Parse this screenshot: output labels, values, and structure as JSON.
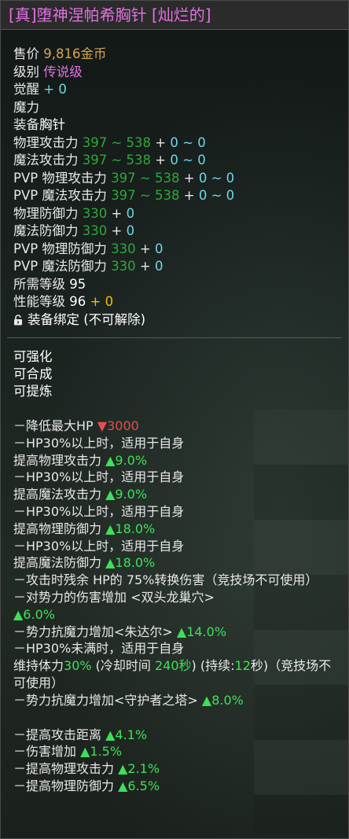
{
  "title": "[真]堕神涅帕希胸针 [灿烂的]",
  "basic": {
    "price_label": "售价",
    "price_value": "9,816金币",
    "grade_label": "级别",
    "grade_value": "传说级",
    "awaken_label": "觉醒",
    "awaken_value": "+ 0",
    "magic_label": "魔力",
    "equip_label": "装备",
    "equip_value": "胸针"
  },
  "stats": [
    {
      "label": "物理攻击力",
      "range": "397 ~ 538",
      "plus": " + ",
      "bonus": "0 ~ 0"
    },
    {
      "label": "魔法攻击力",
      "range": "397 ~ 538",
      "plus": " + ",
      "bonus": "0 ~ 0"
    },
    {
      "label": "PVP 物理攻击力",
      "range": "397 ~ 538",
      "plus": " + ",
      "bonus": "0 ~ 0"
    },
    {
      "label": "PVP 魔法攻击力",
      "range": "397 ~ 538",
      "plus": " + ",
      "bonus": "0 ~ 0"
    },
    {
      "label": "物理防御力",
      "range": "330",
      "plus": " + ",
      "bonus": "0"
    },
    {
      "label": "魔法防御力",
      "range": "330",
      "plus": " + ",
      "bonus": "0"
    },
    {
      "label": "PVP 物理防御力",
      "range": "330",
      "plus": " + ",
      "bonus": "0"
    },
    {
      "label": "PVP 魔法防御力",
      "range": "330",
      "plus": " + ",
      "bonus": "0"
    }
  ],
  "required_level_label": "所需等级",
  "required_level_value": "95",
  "perf_level_label": "性能等级",
  "perf_level_value": "96",
  "perf_level_bonus": "+ 0",
  "bind_text": "装备绑定 (不可解除)",
  "properties": [
    "可强化",
    "可合成",
    "可提炼"
  ],
  "effects": {
    "e1_text": "－降低最大HP ",
    "e1_value": "▼3000",
    "e2": "－HP30%以上时，适用于自身",
    "e3_text": " 提高物理攻击力 ",
    "e3_value": "▲9.0%",
    "e4": "－HP30%以上时，适用于自身",
    "e5_text": " 提高魔法攻击力 ",
    "e5_value": "▲9.0%",
    "e6": "－HP30%以上时，适用于自身",
    "e7_text": " 提高物理防御力 ",
    "e7_value": "▲18.0%",
    "e8": "－HP30%以上时，适用于自身",
    "e9_text": " 提高魔法防御力 ",
    "e9_value": "▲18.0%",
    "e10": "－攻击时残余 HP的 75%转换伤害（竞技场不可使用）",
    "e11": "－对势力的伤害增加 <双头龙巢穴>",
    "e11_value": "▲6.0%",
    "e12_text": "－势力抗魔力增加<朱达尔> ",
    "e12_value": "▲14.0%",
    "e13": "－HP30%未满时，适用于自身",
    "e14_a": " 维持体力",
    "e14_pct": "30%",
    "e14_b": " (冷却时间 ",
    "e14_time": "240秒",
    "e14_c": ") (持续:",
    "e14_dur": "12",
    "e14_d": "秒)（竞技场不可使用）",
    "e15_text": "－势力抗魔力增加<守护者之塔> ",
    "e15_value": "▲8.0%",
    "e16_text": "－提高攻击距离 ",
    "e16_value": "▲4.1%",
    "e17_text": "－伤害增加 ",
    "e17_value": "▲1.5%",
    "e18_text": "－提高物理攻击力 ",
    "e18_value": "▲2.1%",
    "e19_text": "－提高物理防御力 ",
    "e19_value": "▲6.5%"
  },
  "colors": {
    "title": "#e070e0",
    "gold": "#d4a656",
    "cyan": "#6ed7e6",
    "green": "#2ea83a",
    "bright_green": "#3ee05a",
    "yellow": "#f0c000",
    "red": "#e05050"
  },
  "icons": {
    "bind": "lock-icon"
  }
}
